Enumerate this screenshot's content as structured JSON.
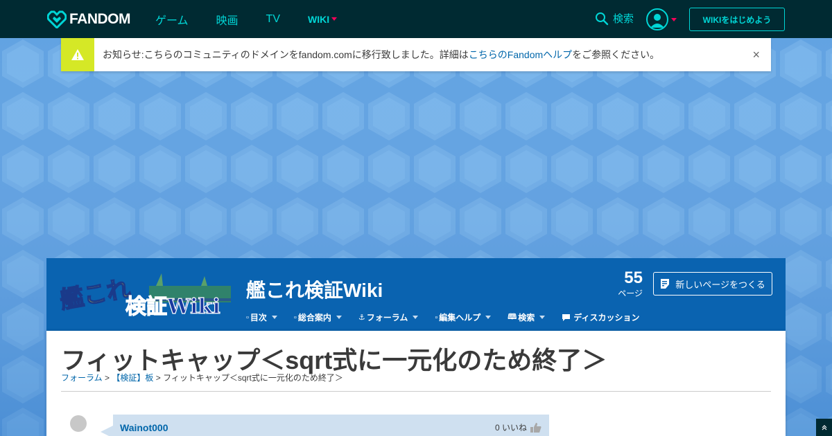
{
  "topbar": {
    "logo_text": "FANDOM",
    "nav": [
      {
        "label": "ゲーム"
      },
      {
        "label": "映画"
      },
      {
        "label": "TV"
      },
      {
        "label": "WIKI"
      }
    ],
    "search_label": "検索",
    "start_wiki_label": "WIKIをはじめよう"
  },
  "notice": {
    "text_before": "お知らせ:こちらのコミュニティのドメインをfandom.comに移行致しました。詳細は",
    "link_text": "こちらのFandomヘルプ",
    "text_after": "をご参照ください。",
    "close": "×"
  },
  "wiki": {
    "logo_text_1": "艦これ",
    "logo_text_2": "検証Wiki",
    "title": "艦これ検証Wiki",
    "page_count": "55",
    "page_count_label": "ページ",
    "new_page_label": "新しいページをつくる",
    "nav": [
      {
        "label": "目次"
      },
      {
        "label": "総合案内"
      },
      {
        "label": "フォーラム"
      },
      {
        "label": "編集ヘルプ"
      },
      {
        "label": "検索"
      },
      {
        "label": "ディスカッション"
      }
    ]
  },
  "page": {
    "title": "フィットキャップ＜sqrt式に一元化のため終了＞",
    "breadcrumb": [
      {
        "label": "フォーラム"
      },
      {
        "label": "【検証】板"
      },
      {
        "label": "フィットキャップ＜sqrt式に一元化のため終了＞"
      }
    ],
    "separator": ">"
  },
  "post": {
    "user": "Wainot000",
    "likes": "0 いいね"
  },
  "colors": {
    "topbar_bg": "#002a32",
    "accent_cyan": "#00d6d6",
    "accent_pink": "#fa005a",
    "wiki_header_bg": "#0a63b0",
    "notice_icon_bg": "#d5e826",
    "link": "#0066aa"
  },
  "icons": {
    "logo": "fandom-heart-icon",
    "search": "search-icon",
    "user": "user-avatar-icon",
    "notice": "warning-icon",
    "close": "close-icon",
    "new_page": "document-edit-icon",
    "discussion": "chat-bubble-icon",
    "like": "thumbs-up-icon",
    "scroll_top": "arrow-up-icon"
  }
}
